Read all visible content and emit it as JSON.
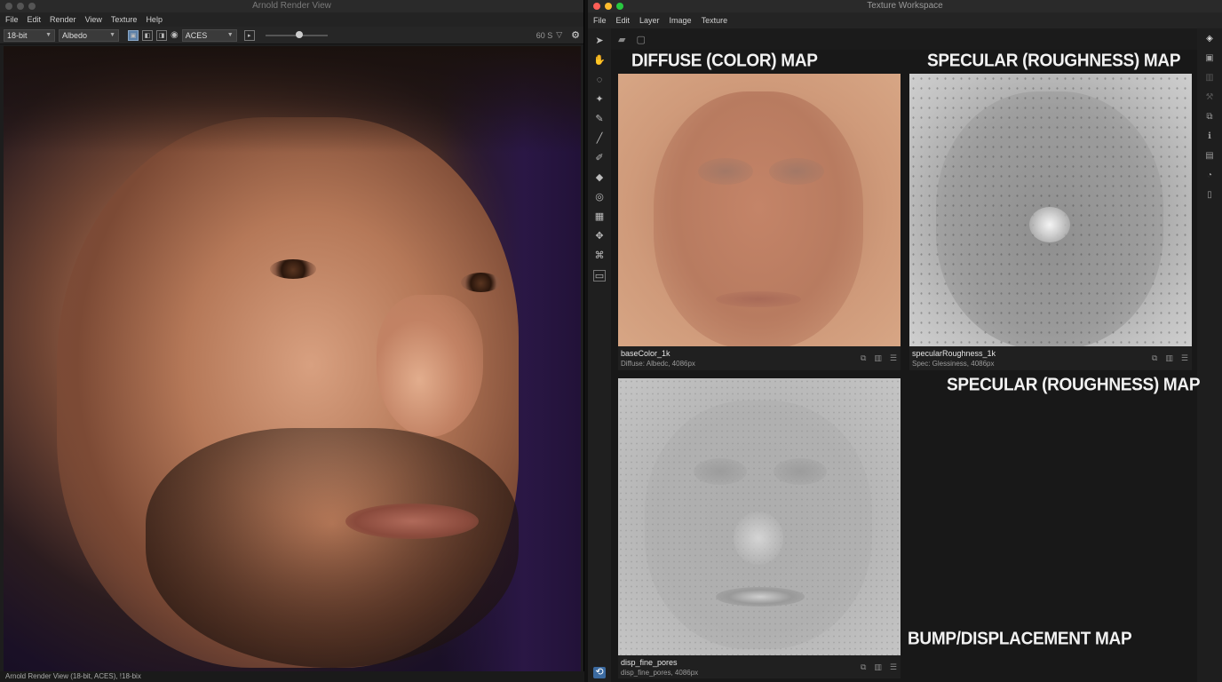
{
  "left_window": {
    "title": "Arnold Render View",
    "menu": [
      "File",
      "Edit",
      "Render",
      "View",
      "Texture",
      "Help"
    ],
    "toolbar": {
      "bit_depth": "18-bit",
      "channel": "Albedo",
      "color_space": "ACES",
      "fps": "60 S"
    },
    "status": "Arnold Render View (18-bit, ACES), !18-bix"
  },
  "right_window": {
    "title": "Texture Workspace",
    "menu": [
      "File",
      "Edit",
      "Layer",
      "Image",
      "Texture"
    ],
    "labels": {
      "diffuse": "DIFFUSE (COLOR) MAP",
      "specular_top": "SPECULAR (ROUGHNESS) MAP",
      "specular_mid": "SPECULAR (ROUGHNESS) MAP",
      "bump": "BUMP/DISPLACEMENT MAP"
    },
    "cards": [
      {
        "name": "baseColor_1k",
        "sub": "Diffuse: Albedc, 4086px"
      },
      {
        "name": "specularRoughness_1k",
        "sub": "Spec: Glessiness, 4086px"
      },
      {
        "name": "disp_fine_pores",
        "sub": "disp_fine_pores, 4086px"
      }
    ]
  },
  "colors": {
    "accent_blue": "#3b6aa0",
    "close": "#ff5f57",
    "minimize": "#febc2e",
    "zoom": "#28c840"
  }
}
